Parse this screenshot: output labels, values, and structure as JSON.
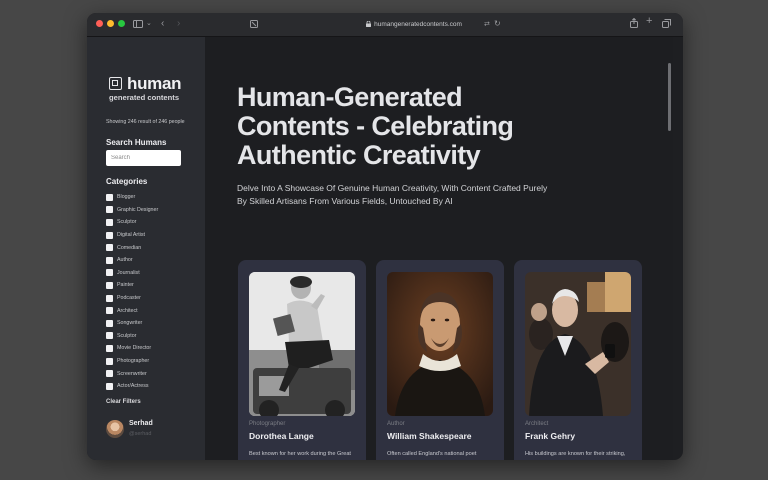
{
  "browser": {
    "url": "humangeneratedcontents.com",
    "icons": [
      "sidebar-toggle-icon",
      "chevron-down-icon",
      "back-icon",
      "forward-icon",
      "tab-overview-icon",
      "lock-icon",
      "translate-icon",
      "reload-icon",
      "share-icon",
      "new-tab-icon",
      "tabs-icon"
    ]
  },
  "sidebar": {
    "logo_word": "human",
    "logo_sub": "generated contents",
    "showing": "Showing 246 result of 246 people",
    "search_heading": "Search Humans",
    "search_placeholder": "Search",
    "categories_heading": "Categories",
    "categories": [
      "Blogger",
      "Graphic Designer",
      "Sculptor",
      "Digital Artist",
      "Comedian",
      "Author",
      "Journalist",
      "Painter",
      "Podcaster",
      "Architect",
      "Songwriter",
      "Sculptor",
      "Movie Director",
      "Photographer",
      "Screenwriter",
      "Actor/Actress"
    ],
    "clear_filters": "Clear Filters",
    "user_name": "Serhad",
    "user_sub": "@serhad"
  },
  "main": {
    "hero": "Human-Generated Contents - Celebrating Authentic Creativity",
    "subtitle": "Delve Into A Showcase Of Genuine Human Creativity, With Content Crafted Purely By Skilled Artisans From Various Fields, Untouched By AI",
    "cards": [
      {
        "role": "Photographer",
        "name": "Dorothea Lange",
        "desc": "Best known for her work during the Great Depression"
      },
      {
        "role": "Author",
        "name": "William Shakespeare",
        "desc": "Often called England's national poet"
      },
      {
        "role": "Architect",
        "name": "Frank Gehry",
        "desc": "His buildings are known for their striking, sculptural forms"
      }
    ]
  },
  "colors": {
    "sidebar_bg": "#2a2c31",
    "main_bg": "#1d1e21",
    "card_bg": "#2f3140",
    "accent_text": "#e4e5e8"
  }
}
